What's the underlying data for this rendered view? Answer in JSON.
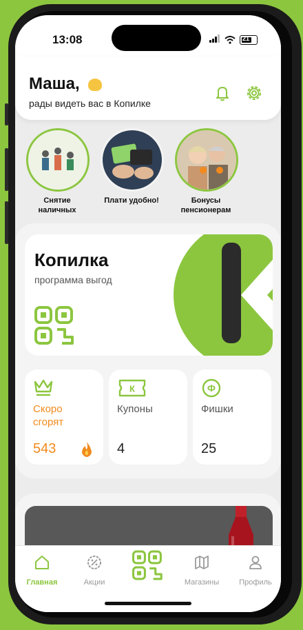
{
  "status_bar": {
    "time": "13:08",
    "battery": "21"
  },
  "header": {
    "greeting": "Маша,",
    "subtitle": "рады видеть вас в Копилке"
  },
  "stories": [
    {
      "label": "Снятие наличных"
    },
    {
      "label": "Плати удобно!"
    },
    {
      "label": "Бонусы пенсионерам"
    }
  ],
  "kopilka_card": {
    "title": "Копилка",
    "subtitle": "программа выгод"
  },
  "mini_cards": [
    {
      "label": "Скоро сгорят",
      "value": "543"
    },
    {
      "label": "Купоны",
      "value": "4",
      "icon_text": "К"
    },
    {
      "label": "Фишки",
      "value": "25",
      "icon_text": "Ф"
    }
  ],
  "tabbar": {
    "items": [
      {
        "label": "Главная",
        "active": true
      },
      {
        "label": "Акции"
      },
      {
        "label": ""
      },
      {
        "label": "Магазины"
      },
      {
        "label": "Профиль"
      }
    ]
  },
  "colors": {
    "accent": "#8cc63f",
    "orange": "#f28a1d"
  }
}
